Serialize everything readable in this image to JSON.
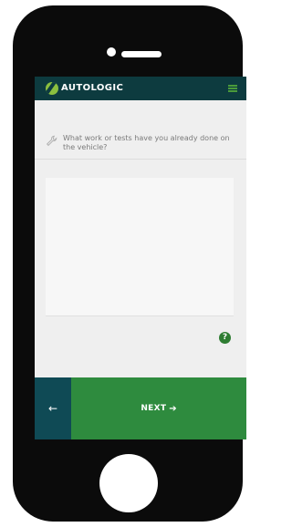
{
  "header": {
    "brand": "AUTOLOGIC",
    "logo_icon": "autologic-logo-icon",
    "menu_icon": "hamburger-menu-icon",
    "brand_color": "#0d3b3f",
    "accent_color": "#8bbf3f"
  },
  "question": {
    "icon": "wrench-icon",
    "text": "What work or tests have you already done on the vehicle?"
  },
  "answer": {
    "value": "",
    "placeholder": ""
  },
  "help": {
    "icon": "help-question-icon",
    "glyph": "?"
  },
  "footer": {
    "back_icon": "arrow-left-icon",
    "back_glyph": "←",
    "next_label": "NEXT",
    "next_icon": "arrow-right-icon",
    "next_glyph": "➔",
    "back_color": "#0f4a55",
    "next_color": "#2e8b3e"
  }
}
